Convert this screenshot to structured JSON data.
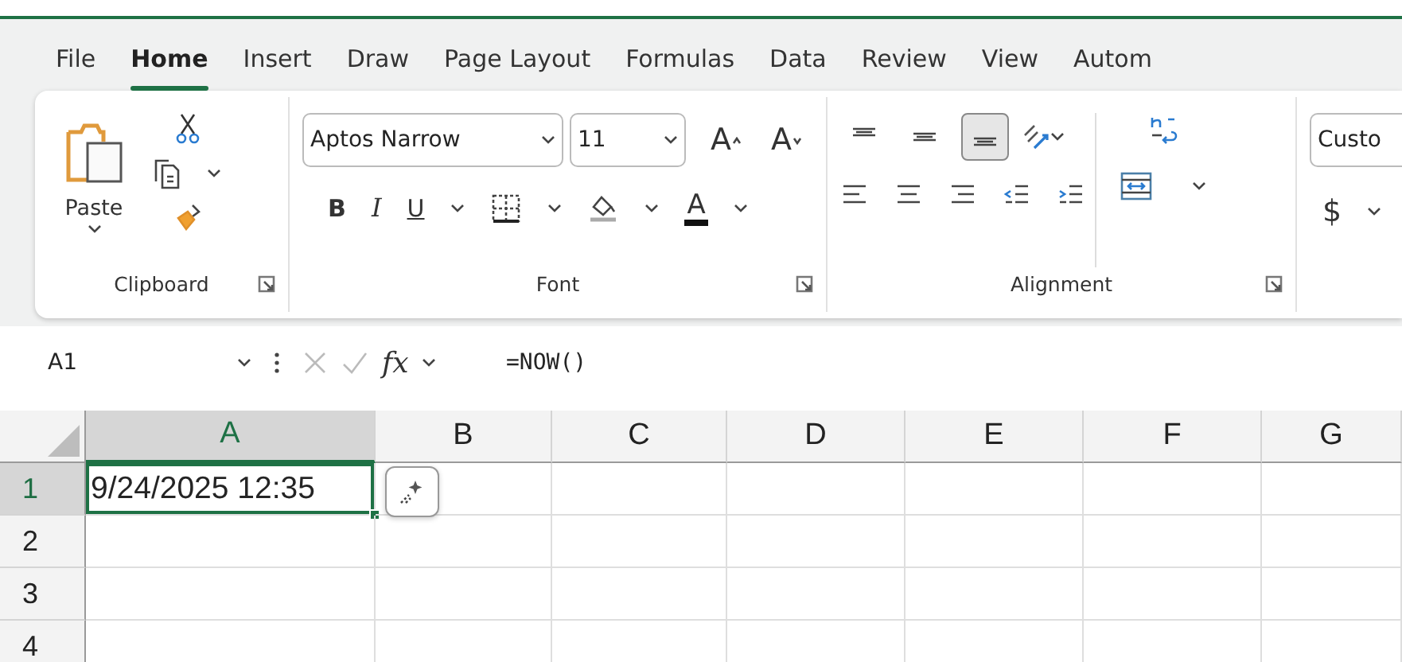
{
  "tabs": [
    {
      "label": "File",
      "selected": false
    },
    {
      "label": "Home",
      "selected": true
    },
    {
      "label": "Insert",
      "selected": false
    },
    {
      "label": "Draw",
      "selected": false
    },
    {
      "label": "Page Layout",
      "selected": false
    },
    {
      "label": "Formulas",
      "selected": false
    },
    {
      "label": "Data",
      "selected": false
    },
    {
      "label": "Review",
      "selected": false
    },
    {
      "label": "View",
      "selected": false
    },
    {
      "label": "Autom",
      "selected": false
    }
  ],
  "clipboard": {
    "paste_label": "Paste",
    "group_label": "Clipboard"
  },
  "font": {
    "font_name": "Aptos Narrow",
    "font_size": "11",
    "grow": "A",
    "shrink": "A",
    "bold": "B",
    "italic": "I",
    "underline": "U",
    "font_color": "A",
    "group_label": "Font"
  },
  "alignment": {
    "vertical": [
      {
        "kind": "top",
        "selected": false
      },
      {
        "kind": "middle",
        "selected": false
      },
      {
        "kind": "bottom",
        "selected": true
      }
    ],
    "group_label": "Alignment"
  },
  "number": {
    "format": "Custo",
    "currency": "$"
  },
  "formula_bar": {
    "name_box": "A1",
    "fx": "fx",
    "formula": "=NOW()"
  },
  "sheet": {
    "columns": [
      {
        "label": "A",
        "selected": true
      },
      {
        "label": "B",
        "selected": false
      },
      {
        "label": "C",
        "selected": false
      },
      {
        "label": "D",
        "selected": false
      },
      {
        "label": "E",
        "selected": false
      },
      {
        "label": "F",
        "selected": false
      },
      {
        "label": "G",
        "selected": false
      }
    ],
    "rows": [
      {
        "label": "1",
        "selected": true,
        "cells": [
          {
            "text": "9/24/2025 12:35",
            "active": true
          }
        ]
      },
      {
        "label": "2",
        "selected": false
      },
      {
        "label": "3",
        "selected": false
      },
      {
        "label": "4",
        "selected": false
      }
    ]
  }
}
